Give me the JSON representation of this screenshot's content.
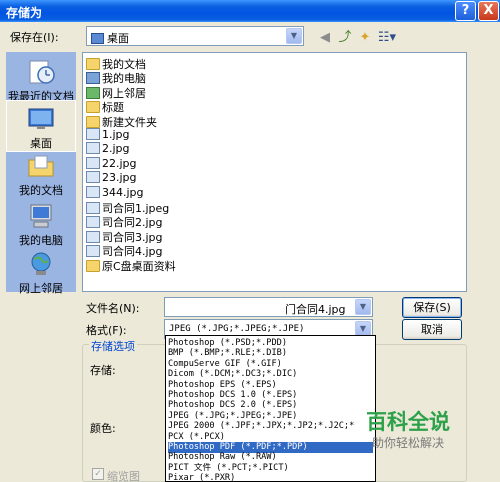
{
  "window": {
    "title": "存储为",
    "help_glyph": "?",
    "close_glyph": "X"
  },
  "savein": {
    "label": "保存在(I):",
    "value": "桌面"
  },
  "places": [
    {
      "label": "我最近的文档",
      "icon": "recent-docs-icon"
    },
    {
      "label": "桌面",
      "icon": "desktop-icon"
    },
    {
      "label": "我的文档",
      "icon": "my-documents-icon"
    },
    {
      "label": "我的电脑",
      "icon": "my-computer-icon"
    },
    {
      "label": "网上邻居",
      "icon": "network-places-icon"
    }
  ],
  "files": [
    {
      "name": "我的文档",
      "icon": "folder"
    },
    {
      "name": "我的电脑",
      "icon": "pc"
    },
    {
      "name": "网上邻居",
      "icon": "net"
    },
    {
      "name": "标题",
      "icon": "folder"
    },
    {
      "name": "新建文件夹",
      "icon": "folder"
    },
    {
      "name": "1.jpg",
      "icon": "jpg"
    },
    {
      "name": "2.jpg",
      "icon": "jpg"
    },
    {
      "name": "22.jpg",
      "icon": "jpg"
    },
    {
      "name": "23.jpg",
      "icon": "jpg"
    },
    {
      "name": "344.jpg",
      "icon": "jpg"
    },
    {
      "name": "司合同1.jpeg",
      "icon": "jpg"
    },
    {
      "name": "司合同2.jpg",
      "icon": "jpg"
    },
    {
      "name": "司合同3.jpg",
      "icon": "jpg"
    },
    {
      "name": "司合同4.jpg",
      "icon": "jpg"
    },
    {
      "name": "原C盘桌面资料",
      "icon": "folder"
    }
  ],
  "filename": {
    "label": "文件名(N):",
    "value": "门合同4.jpg"
  },
  "format": {
    "label": "格式(F):",
    "value": "JPEG (*.JPG;*.JPEG;*.JPE)"
  },
  "buttons": {
    "save": "保存(S)",
    "cancel": "取消"
  },
  "storage": {
    "group_label": "存储选项",
    "store_label": "存储:",
    "color_label": "颜色:",
    "thumbnail_label": "缩览图"
  },
  "format_options": [
    "Photoshop (*.PSD;*.PDD)",
    "BMP (*.BMP;*.RLE;*.DIB)",
    "CompuServe GIF (*.GIF)",
    "Dicom (*.DCM;*.DC3;*.DIC)",
    "Photoshop EPS (*.EPS)",
    "Photoshop DCS 1.0 (*.EPS)",
    "Photoshop DCS 2.0 (*.EPS)",
    "JPEG (*.JPG;*.JPEG;*.JPE)",
    "JPEG 2000 (*.JPF;*.JPX;*.JP2;*.J2C;*",
    "PCX (*.PCX)",
    "Photoshop PDF (*.PDF;*.PDP)",
    "Photoshop Raw (*.RAW)",
    "PICT 文件 (*.PCT;*.PICT)",
    "Pixar (*.PXR)"
  ],
  "selected_format_index": 10,
  "watermark": {
    "main": "百科全说",
    "sub": "助你轻松解决"
  },
  "colors": {
    "titlebar": "#0054E3",
    "places_bg": "#9BB5E3",
    "selection": "#316AC5",
    "watermark_green": "#2DA149"
  }
}
